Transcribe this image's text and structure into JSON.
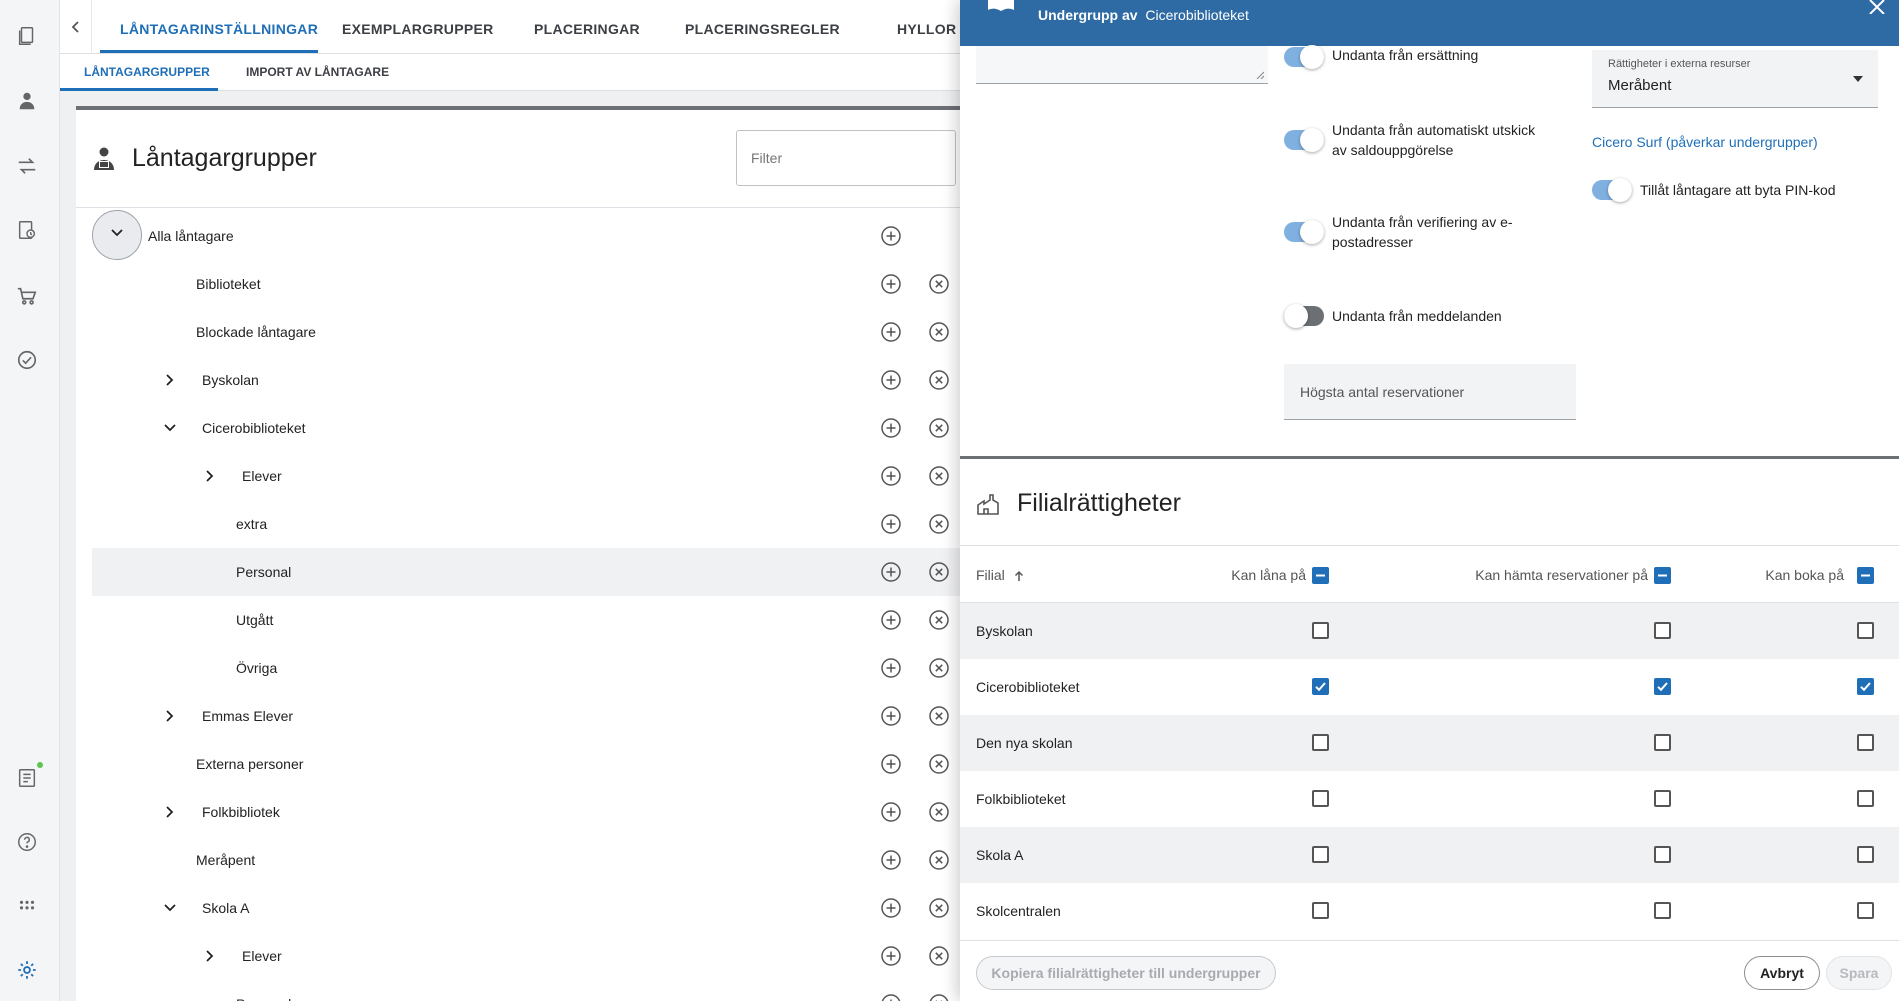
{
  "nav": {
    "tabs": [
      {
        "label": "LÅNTAGARINSTÄLLNINGAR",
        "active": true
      },
      {
        "label": "EXEMPLARGRUPPER",
        "active": false
      },
      {
        "label": "PLACERINGAR",
        "active": false
      },
      {
        "label": "PLACERINGSREGLER",
        "active": false
      },
      {
        "label": "HYLLOR",
        "active": false
      }
    ],
    "subtabs": [
      {
        "label": "LÅNTAGARGRUPPER",
        "active": true
      },
      {
        "label": "IMPORT AV LÅNTAGARE",
        "active": false
      }
    ]
  },
  "rail": {
    "icons": [
      "catalog-icon",
      "patron-icon",
      "circulation-icon",
      "periodicals-icon",
      "acquisitions-icon",
      "checklist-icon",
      "reports-icon",
      "help-icon",
      "apps-icon",
      "settings-icon"
    ]
  },
  "panel": {
    "title": "Låntagargrupper",
    "filter_placeholder": "Filter"
  },
  "tree": [
    {
      "label": "Alla låntagare",
      "level": 0,
      "expander": "root",
      "remove": false,
      "selected": false
    },
    {
      "label": "Biblioteket",
      "level": 1,
      "expander": null,
      "remove": true,
      "selected": false
    },
    {
      "label": "Blockade låntagare",
      "level": 1,
      "expander": null,
      "remove": true,
      "selected": false
    },
    {
      "label": "Byskolan",
      "level": 1,
      "expander": "collapsed",
      "remove": true,
      "selected": false
    },
    {
      "label": "Cicerobiblioteket",
      "level": 1,
      "expander": "expanded",
      "remove": true,
      "selected": false
    },
    {
      "label": "Elever",
      "level": 2,
      "expander": "collapsed",
      "remove": true,
      "selected": false
    },
    {
      "label": "extra",
      "level": 2,
      "expander": null,
      "remove": true,
      "selected": false
    },
    {
      "label": "Personal",
      "level": 2,
      "expander": null,
      "remove": true,
      "selected": true
    },
    {
      "label": "Utgått",
      "level": 2,
      "expander": null,
      "remove": true,
      "selected": false
    },
    {
      "label": "Övriga",
      "level": 2,
      "expander": null,
      "remove": true,
      "selected": false
    },
    {
      "label": "Emmas Elever",
      "level": 1,
      "expander": "collapsed",
      "remove": true,
      "selected": false
    },
    {
      "label": "Externa personer",
      "level": 1,
      "expander": null,
      "remove": true,
      "selected": false
    },
    {
      "label": "Folkbibliotek",
      "level": 1,
      "expander": "collapsed",
      "remove": true,
      "selected": false
    },
    {
      "label": "Meråpent",
      "level": 1,
      "expander": null,
      "remove": true,
      "selected": false
    },
    {
      "label": "Skola A",
      "level": 1,
      "expander": "expanded",
      "remove": true,
      "selected": false
    },
    {
      "label": "Elever",
      "level": 2,
      "expander": "collapsed",
      "remove": true,
      "selected": false
    },
    {
      "label": "Personal",
      "level": 2,
      "expander": null,
      "remove": true,
      "selected": false
    }
  ],
  "drawer": {
    "title_prefix": "Undergrupp av",
    "title_parent": "Cicerobiblioteket",
    "toggles": [
      {
        "label": "Undanta från ersättning",
        "on": true
      },
      {
        "label": "Undanta från automatiskt utskick av saldouppgörelse",
        "on": true
      },
      {
        "label": "Undanta från verifiering av e-postadresser",
        "on": true
      },
      {
        "label": "Undanta från meddelanden",
        "on": false
      }
    ],
    "external_resources": {
      "label": "Rättigheter i externa resurser",
      "value": "Meråbent"
    },
    "cicero_surf_link": "Cicero Surf (påverkar undergrupper)",
    "pin_toggle": {
      "label": "Tillåt låntagare att byta PIN-kod",
      "on": true
    },
    "max_reservations_placeholder": "Högsta antal reservationer",
    "branch_rights": {
      "title": "Filialrättigheter",
      "columns": {
        "branch": "Filial",
        "loan": "Kan låna på",
        "pickup": "Kan hämta reservationer på",
        "book": "Kan boka på"
      },
      "rows": [
        {
          "branch": "Byskolan",
          "loan": false,
          "pickup": false,
          "book": false
        },
        {
          "branch": "Cicerobiblioteket",
          "loan": true,
          "pickup": true,
          "book": true
        },
        {
          "branch": "Den nya skolan",
          "loan": false,
          "pickup": false,
          "book": false
        },
        {
          "branch": "Folkbiblioteket",
          "loan": false,
          "pickup": false,
          "book": false
        },
        {
          "branch": "Skola A",
          "loan": false,
          "pickup": false,
          "book": false
        },
        {
          "branch": "Skolcentralen",
          "loan": false,
          "pickup": false,
          "book": false
        }
      ]
    },
    "footer": {
      "copy_button": "Kopiera filialrättigheter till undergrupper",
      "cancel_button": "Avbryt",
      "save_button": "Spara"
    }
  },
  "colors": {
    "accent": "#1f6fb8",
    "header": "#2e6aa3",
    "toggle_on": "#7fb0e0",
    "toggle_off": "#6c6f73"
  }
}
